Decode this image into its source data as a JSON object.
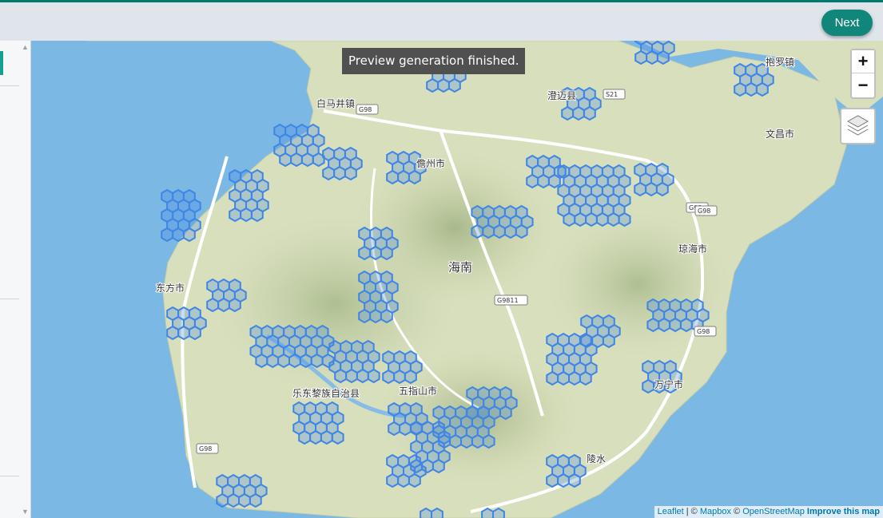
{
  "toolbar": {
    "next_label": "Next"
  },
  "toast": {
    "text": "Preview generation finished."
  },
  "map": {
    "zoom_in": "+",
    "zoom_out": "−",
    "layers_icon": "layers-icon",
    "labels": [
      "白马井镇",
      "澄迈县",
      "抱罗镇",
      "文昌市",
      "儋州市",
      "海南",
      "东方市",
      "乐东黎族自治县",
      "五指山市",
      "琼海市",
      "万宁市",
      "陵水"
    ],
    "roads": [
      "G98",
      "S21",
      "G98",
      "G9811",
      "G98",
      "G98",
      "G98"
    ],
    "colors": {
      "water": "#7bb8e4",
      "land": "#d7dfbd",
      "mountain": "#b8c49a",
      "hexagon": "#3f86e4",
      "accent": "#11877b"
    }
  },
  "attribution": {
    "leaflet": "Leaflet",
    "mapbox": "Mapbox",
    "osm": "OpenStreetMap",
    "improve": "Improve this map",
    "sep1": " | © ",
    "sep2": " © "
  }
}
